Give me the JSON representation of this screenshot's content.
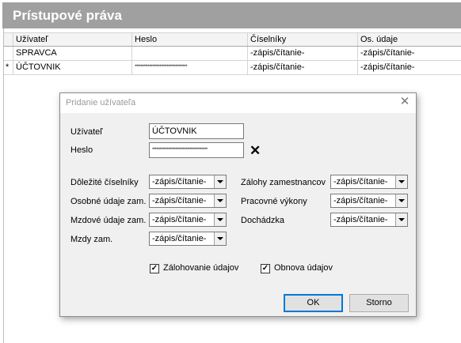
{
  "header": {
    "title": "Prístupové práva"
  },
  "grid": {
    "columns": [
      "Užívateľ",
      "Heslo",
      "Číselníky",
      "Os. údaje"
    ],
    "rows": [
      {
        "indicator": "",
        "user": "SPRAVCA",
        "password": "",
        "codebooks": "-zápis/čítanie-",
        "personal": "-zápis/čítanie-"
      },
      {
        "indicator": "*",
        "user": "ÚČTOVNIK",
        "password": "************************************",
        "codebooks": "-zápis/čítanie-",
        "personal": "-zápis/čítanie-"
      }
    ]
  },
  "dialog": {
    "title": "Pridanie užívateľa",
    "close_glyph": "✕",
    "user_label": "Užívateľ",
    "user_value": "ÚČTOVNIK",
    "password_label": "Heslo",
    "password_value": "**************************************",
    "clear_glyph": "✕",
    "permissions": {
      "codebooks": {
        "label": "Dôležité číselníky",
        "value": "-zápis/čítanie-"
      },
      "personal_data": {
        "label": "Osobné údaje zam.",
        "value": "-zápis/čítanie-"
      },
      "wage_data": {
        "label": "Mzdové údaje zam.",
        "value": "-zápis/čítanie-"
      },
      "wages": {
        "label": "Mzdy zam.",
        "value": "-zápis/čítanie-"
      },
      "advances": {
        "label": "Zálohy zamestnancov",
        "value": "-zápis/čítanie-"
      },
      "work_output": {
        "label": "Pracovné výkony",
        "value": "-zápis/čítanie-"
      },
      "attendance": {
        "label": "Dochádzka",
        "value": "-zápis/čítanie-"
      }
    },
    "backup": {
      "label": "Zálohovanie údajov",
      "checked": true,
      "mark": "✓"
    },
    "restore": {
      "label": "Obnova údajov",
      "checked": true,
      "mark": "✓"
    },
    "ok_label": "OK",
    "cancel_label": "Storno"
  }
}
